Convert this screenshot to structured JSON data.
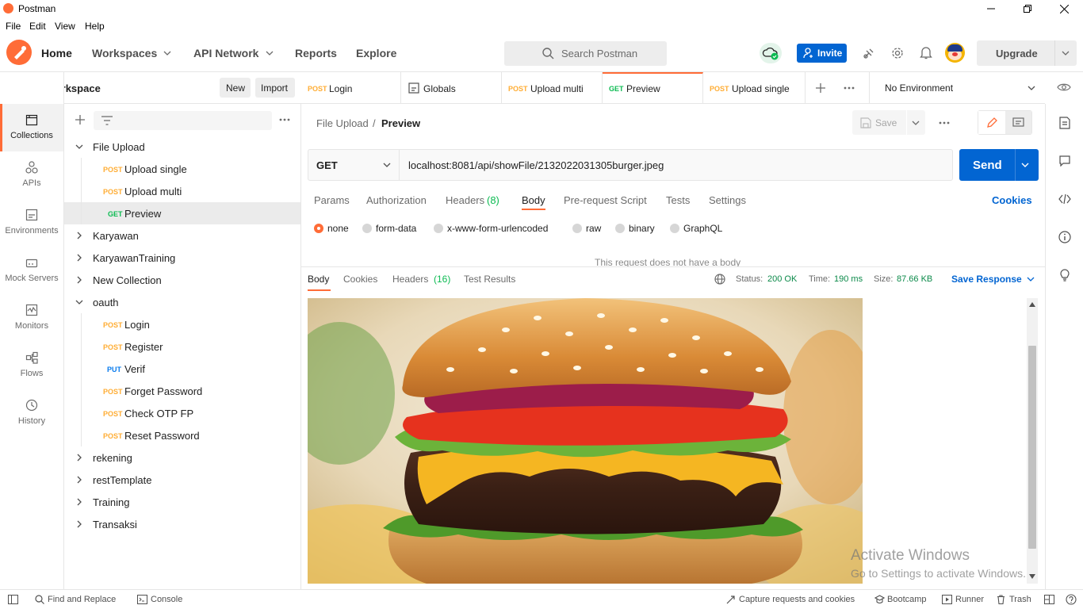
{
  "window": {
    "title": "Postman"
  },
  "menu": [
    "File",
    "Edit",
    "View",
    "Help"
  ],
  "header": {
    "home": "Home",
    "workspaces": "Workspaces",
    "api_network": "API Network",
    "reports": "Reports",
    "explore": "Explore",
    "search_placeholder": "Search Postman",
    "invite": "Invite",
    "upgrade": "Upgrade"
  },
  "workspace": {
    "title": "My Workspace",
    "new": "New",
    "import": "Import"
  },
  "rail": [
    {
      "label": "Collections",
      "icon": "collections-icon"
    },
    {
      "label": "APIs",
      "icon": "apis-icon"
    },
    {
      "label": "Environments",
      "icon": "environments-icon"
    },
    {
      "label": "Mock Servers",
      "icon": "mock-servers-icon"
    },
    {
      "label": "Monitors",
      "icon": "monitors-icon"
    },
    {
      "label": "Flows",
      "icon": "flows-icon"
    },
    {
      "label": "History",
      "icon": "history-icon"
    }
  ],
  "tree": [
    {
      "type": "folder",
      "label": "File Upload",
      "open": true
    },
    {
      "type": "req",
      "method": "POST",
      "label": "Upload single"
    },
    {
      "type": "req",
      "method": "POST",
      "label": "Upload multi"
    },
    {
      "type": "req",
      "method": "GET",
      "label": "Preview",
      "selected": true
    },
    {
      "type": "folder",
      "label": "Karyawan",
      "open": false
    },
    {
      "type": "folder",
      "label": "KaryawanTraining",
      "open": false
    },
    {
      "type": "folder",
      "label": "New Collection",
      "open": false
    },
    {
      "type": "folder",
      "label": "oauth",
      "open": true
    },
    {
      "type": "req",
      "method": "POST",
      "label": "Login"
    },
    {
      "type": "req",
      "method": "POST",
      "label": "Register"
    },
    {
      "type": "req",
      "method": "PUT",
      "label": "Verif"
    },
    {
      "type": "req",
      "method": "POST",
      "label": "Forget Password"
    },
    {
      "type": "req",
      "method": "POST",
      "label": "Check OTP FP"
    },
    {
      "type": "req",
      "method": "POST",
      "label": "Reset Password"
    },
    {
      "type": "folder",
      "label": "rekening",
      "open": false
    },
    {
      "type": "folder",
      "label": "restTemplate",
      "open": false
    },
    {
      "type": "folder",
      "label": "Training",
      "open": false
    },
    {
      "type": "folder",
      "label": "Transaksi",
      "open": false
    }
  ],
  "tabs": [
    {
      "method": "POST",
      "label": "Login"
    },
    {
      "method": "",
      "label": "Globals"
    },
    {
      "method": "POST",
      "label": "Upload multi"
    },
    {
      "method": "GET",
      "label": "Preview",
      "active": true
    },
    {
      "method": "POST",
      "label": "Upload single"
    }
  ],
  "environment": "No Environment",
  "request": {
    "breadcrumb_parent": "File Upload",
    "breadcrumb_sep": "/",
    "name": "Preview",
    "save": "Save",
    "method": "GET",
    "url": "localhost:8081/api/showFile/2132022031305burger.jpeg",
    "send": "Send",
    "tabs": [
      "Params",
      "Authorization",
      "Headers",
      "Body",
      "Pre-request Script",
      "Tests",
      "Settings"
    ],
    "headers_count": "(8)",
    "cookies": "Cookies",
    "body_modes": [
      "none",
      "form-data",
      "x-www-form-urlencoded",
      "raw",
      "binary",
      "GraphQL"
    ],
    "no_body_text": "This request does not have a body"
  },
  "response": {
    "tabs": [
      "Body",
      "Cookies",
      "Headers",
      "Test Results"
    ],
    "headers_count": "(16)",
    "status_label": "Status:",
    "status": "200 OK",
    "time_label": "Time:",
    "time": "190 ms",
    "size_label": "Size:",
    "size": "87.66 KB",
    "save_response": "Save Response"
  },
  "watermark": {
    "line1": "Activate Windows",
    "line2": "Go to Settings to activate Windows."
  },
  "statusbar": {
    "find_replace": "Find and Replace",
    "console": "Console",
    "capture": "Capture requests and cookies",
    "bootcamp": "Bootcamp",
    "runner": "Runner",
    "trash": "Trash"
  },
  "colors": {
    "accent": "#ff6c37",
    "primary": "#0265d2",
    "post": "#ffad34",
    "get": "#0cbb52",
    "put": "#097bed",
    "ok": "#0c8a4a"
  }
}
